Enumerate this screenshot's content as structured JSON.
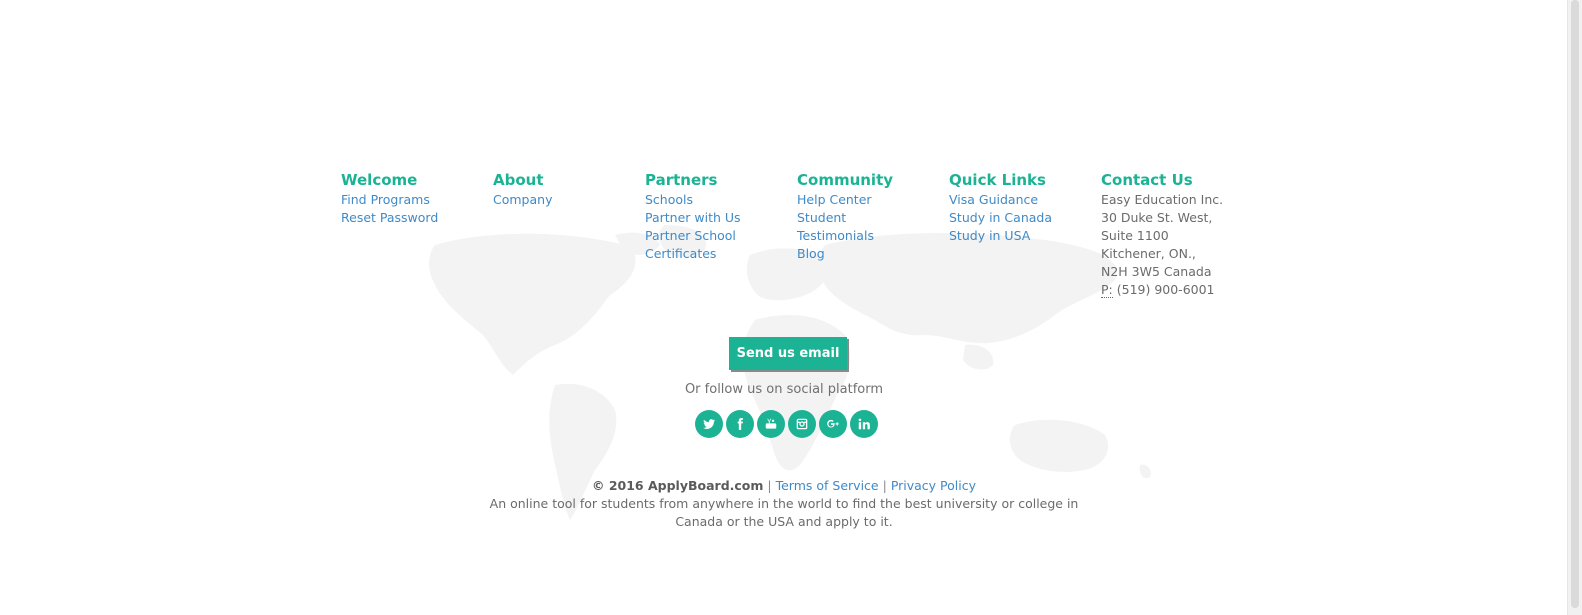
{
  "columns": [
    {
      "title": "Welcome",
      "links": [
        "Find Programs",
        "Reset Password"
      ]
    },
    {
      "title": "About",
      "links": [
        "Company"
      ]
    },
    {
      "title": "Partners",
      "links": [
        "Schools",
        "Partner with Us",
        "Partner School",
        "Certificates"
      ]
    },
    {
      "title": "Community",
      "links": [
        "Help Center",
        "Student",
        "Testimonials",
        "Blog"
      ]
    },
    {
      "title": "Quick Links",
      "links": [
        "Visa Guidance",
        "Study in Canada",
        "Study in USA"
      ]
    }
  ],
  "contact": {
    "title": "Contact Us",
    "lines": [
      "Easy Education Inc.",
      "30 Duke St. West,",
      "Suite 1100",
      "Kitchener, ON.,",
      "N2H 3W5 Canada"
    ],
    "phone_label": "P:",
    "phone": "(519) 900-6001"
  },
  "email_button": "Send us email",
  "follow_text": "Or follow us on social platform",
  "social": [
    {
      "name": "twitter-icon",
      "glyph": "t"
    },
    {
      "name": "facebook-icon",
      "glyph": "f"
    },
    {
      "name": "youtube-icon",
      "glyph": "You"
    },
    {
      "name": "instagram-icon",
      "glyph": "ig"
    },
    {
      "name": "google-plus-icon",
      "glyph": "G+"
    },
    {
      "name": "linkedin-icon",
      "glyph": "in"
    }
  ],
  "legal": {
    "copyright": "© 2016 ApplyBoard.com",
    "terms": "Terms of Service",
    "privacy": "Privacy Policy",
    "separator": "|",
    "tagline_1": "An online tool for students from anywhere in the world to find the best university or college in",
    "tagline_2": "Canada or the USA and apply to it."
  },
  "colors": {
    "accent": "#1bb394",
    "link": "#3e8ac9",
    "text": "#6b6b6b",
    "map": "#f2f2f2"
  }
}
